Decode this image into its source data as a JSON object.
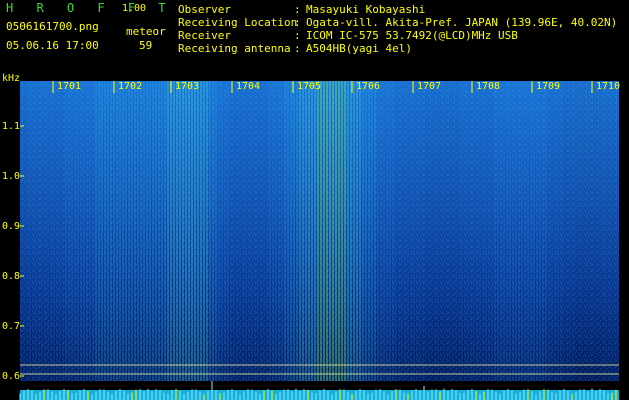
{
  "app": {
    "title": "H R O F F T",
    "version": "1.00",
    "file_name": "0506161700.png",
    "detector_label": "meteor",
    "timestamp": "05.06.16 17:00",
    "meteor_count": "59"
  },
  "metadata": {
    "rows": [
      {
        "label": "Observer",
        "value": "Masayuki Kobayashi"
      },
      {
        "label": "Receiving Location",
        "value": "Ogata-vill. Akita-Pref. JAPAN (139.96E, 40.02N)"
      },
      {
        "label": "Receiver",
        "value": "ICOM IC-575 53.7492(@LCD)MHz USB"
      },
      {
        "label": "Receiving antenna",
        "value": "A504HB(yagi 4el)"
      }
    ]
  },
  "spectrogram": {
    "frequency_unit": "kHz",
    "time_markers": [
      "1701",
      "1702",
      "1703",
      "1704",
      "1705",
      "1706",
      "1707",
      "1708",
      "1709",
      "1710"
    ],
    "frequency_ticks": [
      "1.1",
      "1.0",
      "0.9",
      "0.8",
      "0.7",
      "0.6"
    ],
    "colors": {
      "background": "#000000",
      "low": "#000046",
      "mid": "#0064c8",
      "high": "#00dcdc",
      "peak": "#78ff78",
      "axis_text": "#ffff00",
      "guide_lines": "#ffff64"
    }
  }
}
